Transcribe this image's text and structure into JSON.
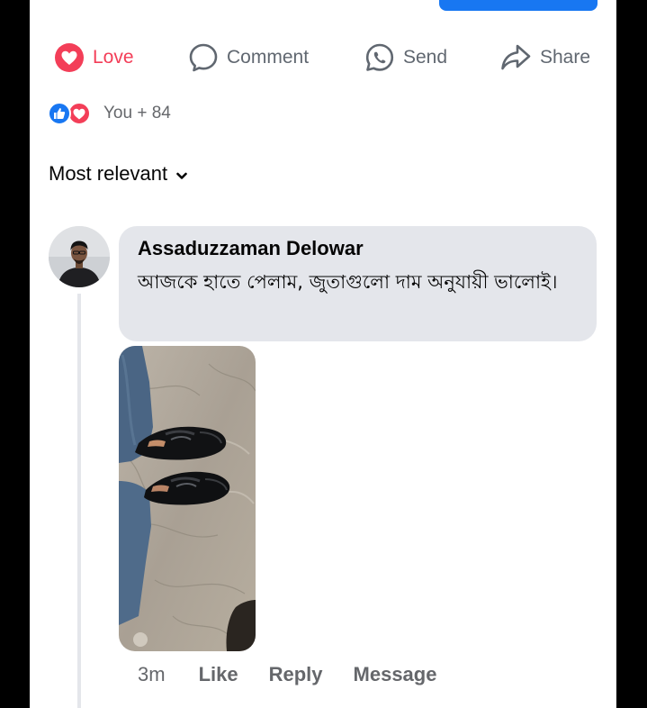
{
  "actions": {
    "love": "Love",
    "comment": "Comment",
    "send": "Send",
    "share": "Share"
  },
  "reactions": {
    "summary": "You + 84"
  },
  "sort": {
    "label": "Most relevant"
  },
  "comment": {
    "author": "Assaduzzaman Delowar",
    "text": "আজকে হাতে পেলাম, জুতাগুলো দাম অনুযায়ী ভালোই।",
    "time": "3m",
    "like_label": "Like",
    "reply_label": "Reply",
    "message_label": "Message"
  },
  "colors": {
    "love": "#f33e58",
    "brand": "#1877f2",
    "bubble": "#e4e6eb"
  }
}
